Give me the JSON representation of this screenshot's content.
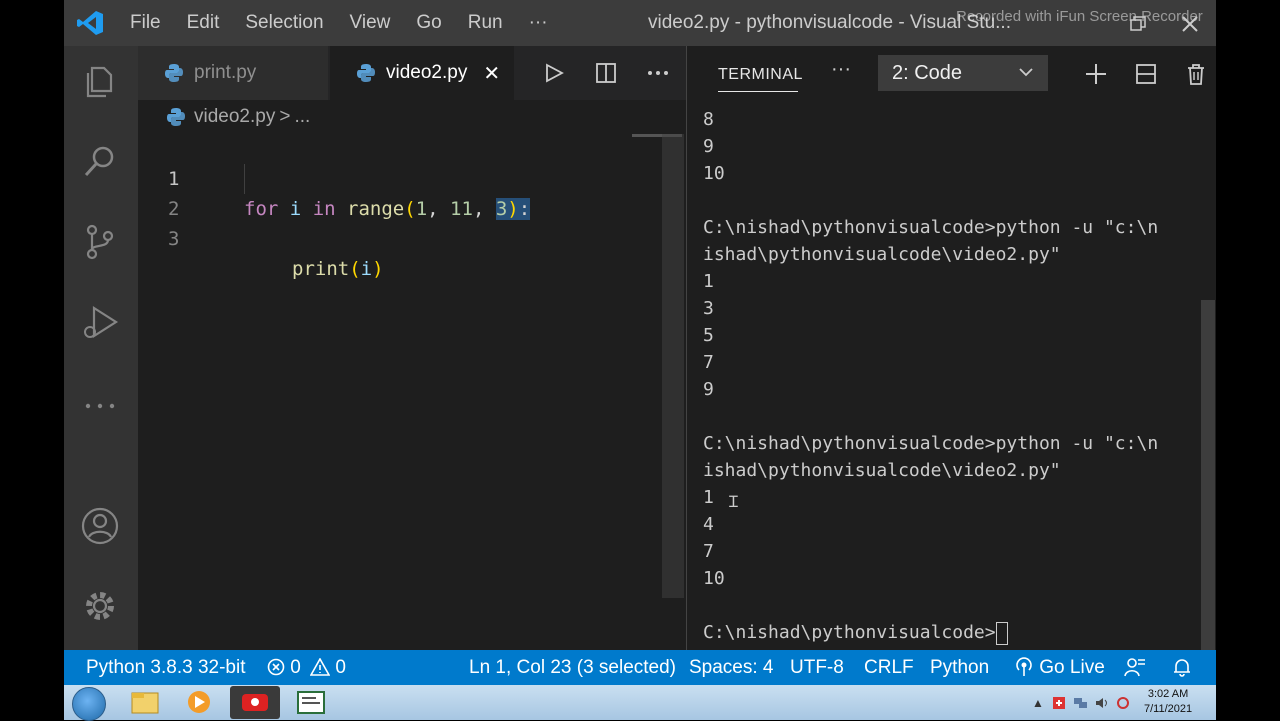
{
  "titlebar": {
    "menu": [
      "File",
      "Edit",
      "Selection",
      "View",
      "Go",
      "Run",
      "···"
    ],
    "window_title": "video2.py - pythonvisualcode - Visual Stu...",
    "watermark": "Recorded with iFun Screen Recorder"
  },
  "editor": {
    "tabs": [
      {
        "label": "print.py",
        "active": false
      },
      {
        "label": "video2.py",
        "active": true,
        "close": "✕"
      }
    ],
    "breadcrumb": {
      "file": "video2.py",
      "sep": ">",
      "rest": "..."
    },
    "lines": [
      {
        "num": "1"
      },
      {
        "num": "2"
      },
      {
        "num": "3"
      }
    ],
    "code": {
      "l1": {
        "kw1": "for",
        "var": "i",
        "kw2": "in",
        "fn": "range",
        "open": "(",
        "n1": "1",
        "c1": ",",
        "n2": "11",
        "c2": ",",
        "n3": "3",
        "close": ")",
        "colon": ":"
      },
      "l2": {
        "fn": "print",
        "open": "(",
        "arg": "i",
        "close": ")"
      }
    }
  },
  "panel": {
    "tab_label": "TERMINAL",
    "more": "···",
    "terminal_select": "2: Code",
    "terminal_lines": [
      "8",
      "9",
      "10",
      "",
      "C:\\nishad\\pythonvisualcode>python -u \"c:\\n",
      "ishad\\pythonvisualcode\\video2.py\"",
      "1",
      "3",
      "5",
      "7",
      "9",
      "",
      "C:\\nishad\\pythonvisualcode>python -u \"c:\\n",
      "ishad\\pythonvisualcode\\video2.py\"",
      "1",
      "4",
      "7",
      "10",
      ""
    ],
    "prompt": "C:\\nishad\\pythonvisualcode>"
  },
  "statusbar": {
    "interpreter": "Python 3.8.3 32-bit",
    "errors": "0",
    "warnings": "0",
    "position": "Ln 1, Col 23 (3 selected)",
    "spaces": "Spaces: 4",
    "encoding": "UTF-8",
    "eol": "CRLF",
    "language": "Python",
    "golive": "Go Live"
  },
  "taskbar": {
    "time": "3:02 AM",
    "date": "7/11/2021"
  },
  "colors": {
    "accent": "#007acc",
    "editor_bg": "#1e1e1e",
    "titlebar_bg": "#3c3c3c",
    "activity_bg": "#333333",
    "keyword": "#c586c0",
    "function": "#dcdcaa",
    "number": "#b5cea8",
    "variable": "#9cdcfe"
  },
  "icons": [
    "vscode-logo-icon",
    "explorer-icon",
    "search-icon",
    "source-control-icon",
    "run-debug-icon",
    "more-icon",
    "account-icon",
    "settings-gear-icon",
    "python-file-icon",
    "run-icon",
    "split-editor-icon",
    "add-terminal-icon",
    "maximize-panel-icon",
    "trash-icon",
    "chevron-down-icon",
    "error-icon",
    "warning-icon",
    "broadcast-icon",
    "feedback-icon",
    "bell-icon",
    "windows-start-icon"
  ]
}
